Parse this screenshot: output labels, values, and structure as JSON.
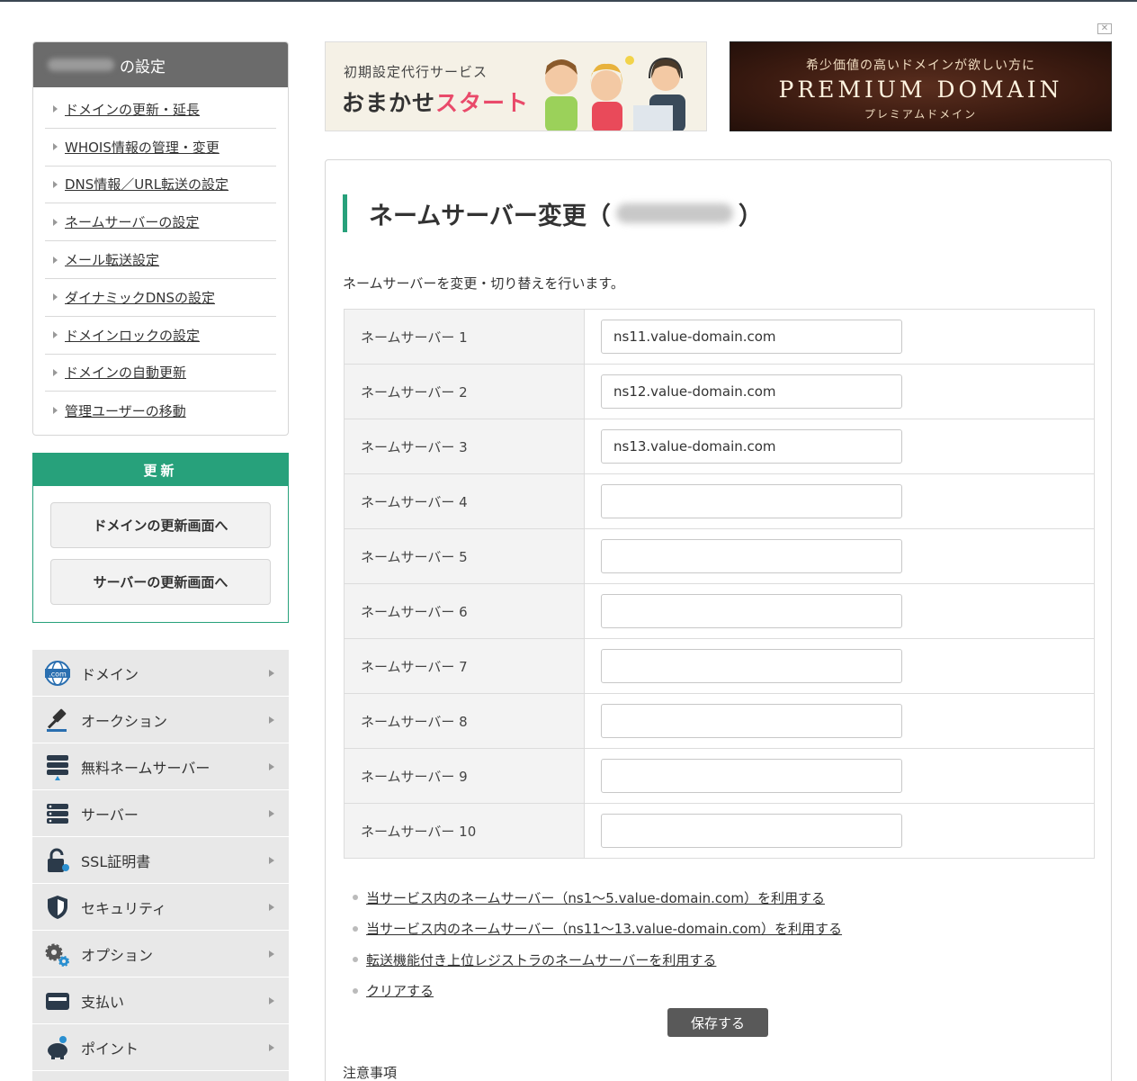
{
  "sidebar": {
    "settings_title": "の設定",
    "settings_items": [
      "ドメインの更新・延長",
      "WHOIS情報の管理・変更",
      "DNS情報／URL転送の設定",
      "ネームサーバーの設定",
      "メール転送設定",
      "ダイナミックDNSの設定",
      "ドメインロックの設定",
      "ドメインの自動更新",
      "管理ユーザーの移動"
    ],
    "renew": {
      "title": "更新",
      "domain_button": "ドメインの更新画面へ",
      "server_button": "サーバーの更新画面へ"
    },
    "nav": [
      {
        "label": "ドメイン",
        "icon": "globe-com-icon"
      },
      {
        "label": "オークション",
        "icon": "gavel-icon"
      },
      {
        "label": "無料ネームサーバー",
        "icon": "server-stack-icon"
      },
      {
        "label": "サーバー",
        "icon": "server-icon"
      },
      {
        "label": "SSL証明書",
        "icon": "lock-icon"
      },
      {
        "label": "セキュリティ",
        "icon": "shield-icon"
      },
      {
        "label": "オプション",
        "icon": "gears-icon"
      },
      {
        "label": "支払い",
        "icon": "wallet-icon"
      },
      {
        "label": "ポイント",
        "icon": "piggy-bank-icon"
      }
    ]
  },
  "banners": {
    "omakase_sub": "初期設定代行サービス",
    "omakase_main_1": "おまかせ",
    "omakase_main_2": "スタート",
    "premium_sub": "希少価値の高いドメインが欲しい方に",
    "premium_main": "PREMIUM DOMAIN",
    "premium_kana": "プレミアムドメイン"
  },
  "main": {
    "title_prefix": "ネームサーバー変更（",
    "title_suffix": "）",
    "description": "ネームサーバーを変更・切り替えを行います。",
    "nameservers": [
      {
        "label": "ネームサーバー 1",
        "value": "ns11.value-domain.com"
      },
      {
        "label": "ネームサーバー 2",
        "value": "ns12.value-domain.com"
      },
      {
        "label": "ネームサーバー 3",
        "value": "ns13.value-domain.com"
      },
      {
        "label": "ネームサーバー 4",
        "value": ""
      },
      {
        "label": "ネームサーバー 5",
        "value": ""
      },
      {
        "label": "ネームサーバー 6",
        "value": ""
      },
      {
        "label": "ネームサーバー 7",
        "value": ""
      },
      {
        "label": "ネームサーバー 8",
        "value": ""
      },
      {
        "label": "ネームサーバー 9",
        "value": ""
      },
      {
        "label": "ネームサーバー 10",
        "value": ""
      }
    ],
    "links": [
      "当サービス内のネームサーバー（ns1〜5.value-domain.com）を利用する",
      "当サービス内のネームサーバー（ns11〜13.value-domain.com）を利用する",
      "転送機能付き上位レジストラのネームサーバーを利用する",
      "クリアする"
    ],
    "save_button": "保存する",
    "notes_title": "注意事項"
  },
  "colors": {
    "accent_green": "#27a17b",
    "sidebar_header": "#6b6b6b",
    "save_button": "#595959"
  }
}
